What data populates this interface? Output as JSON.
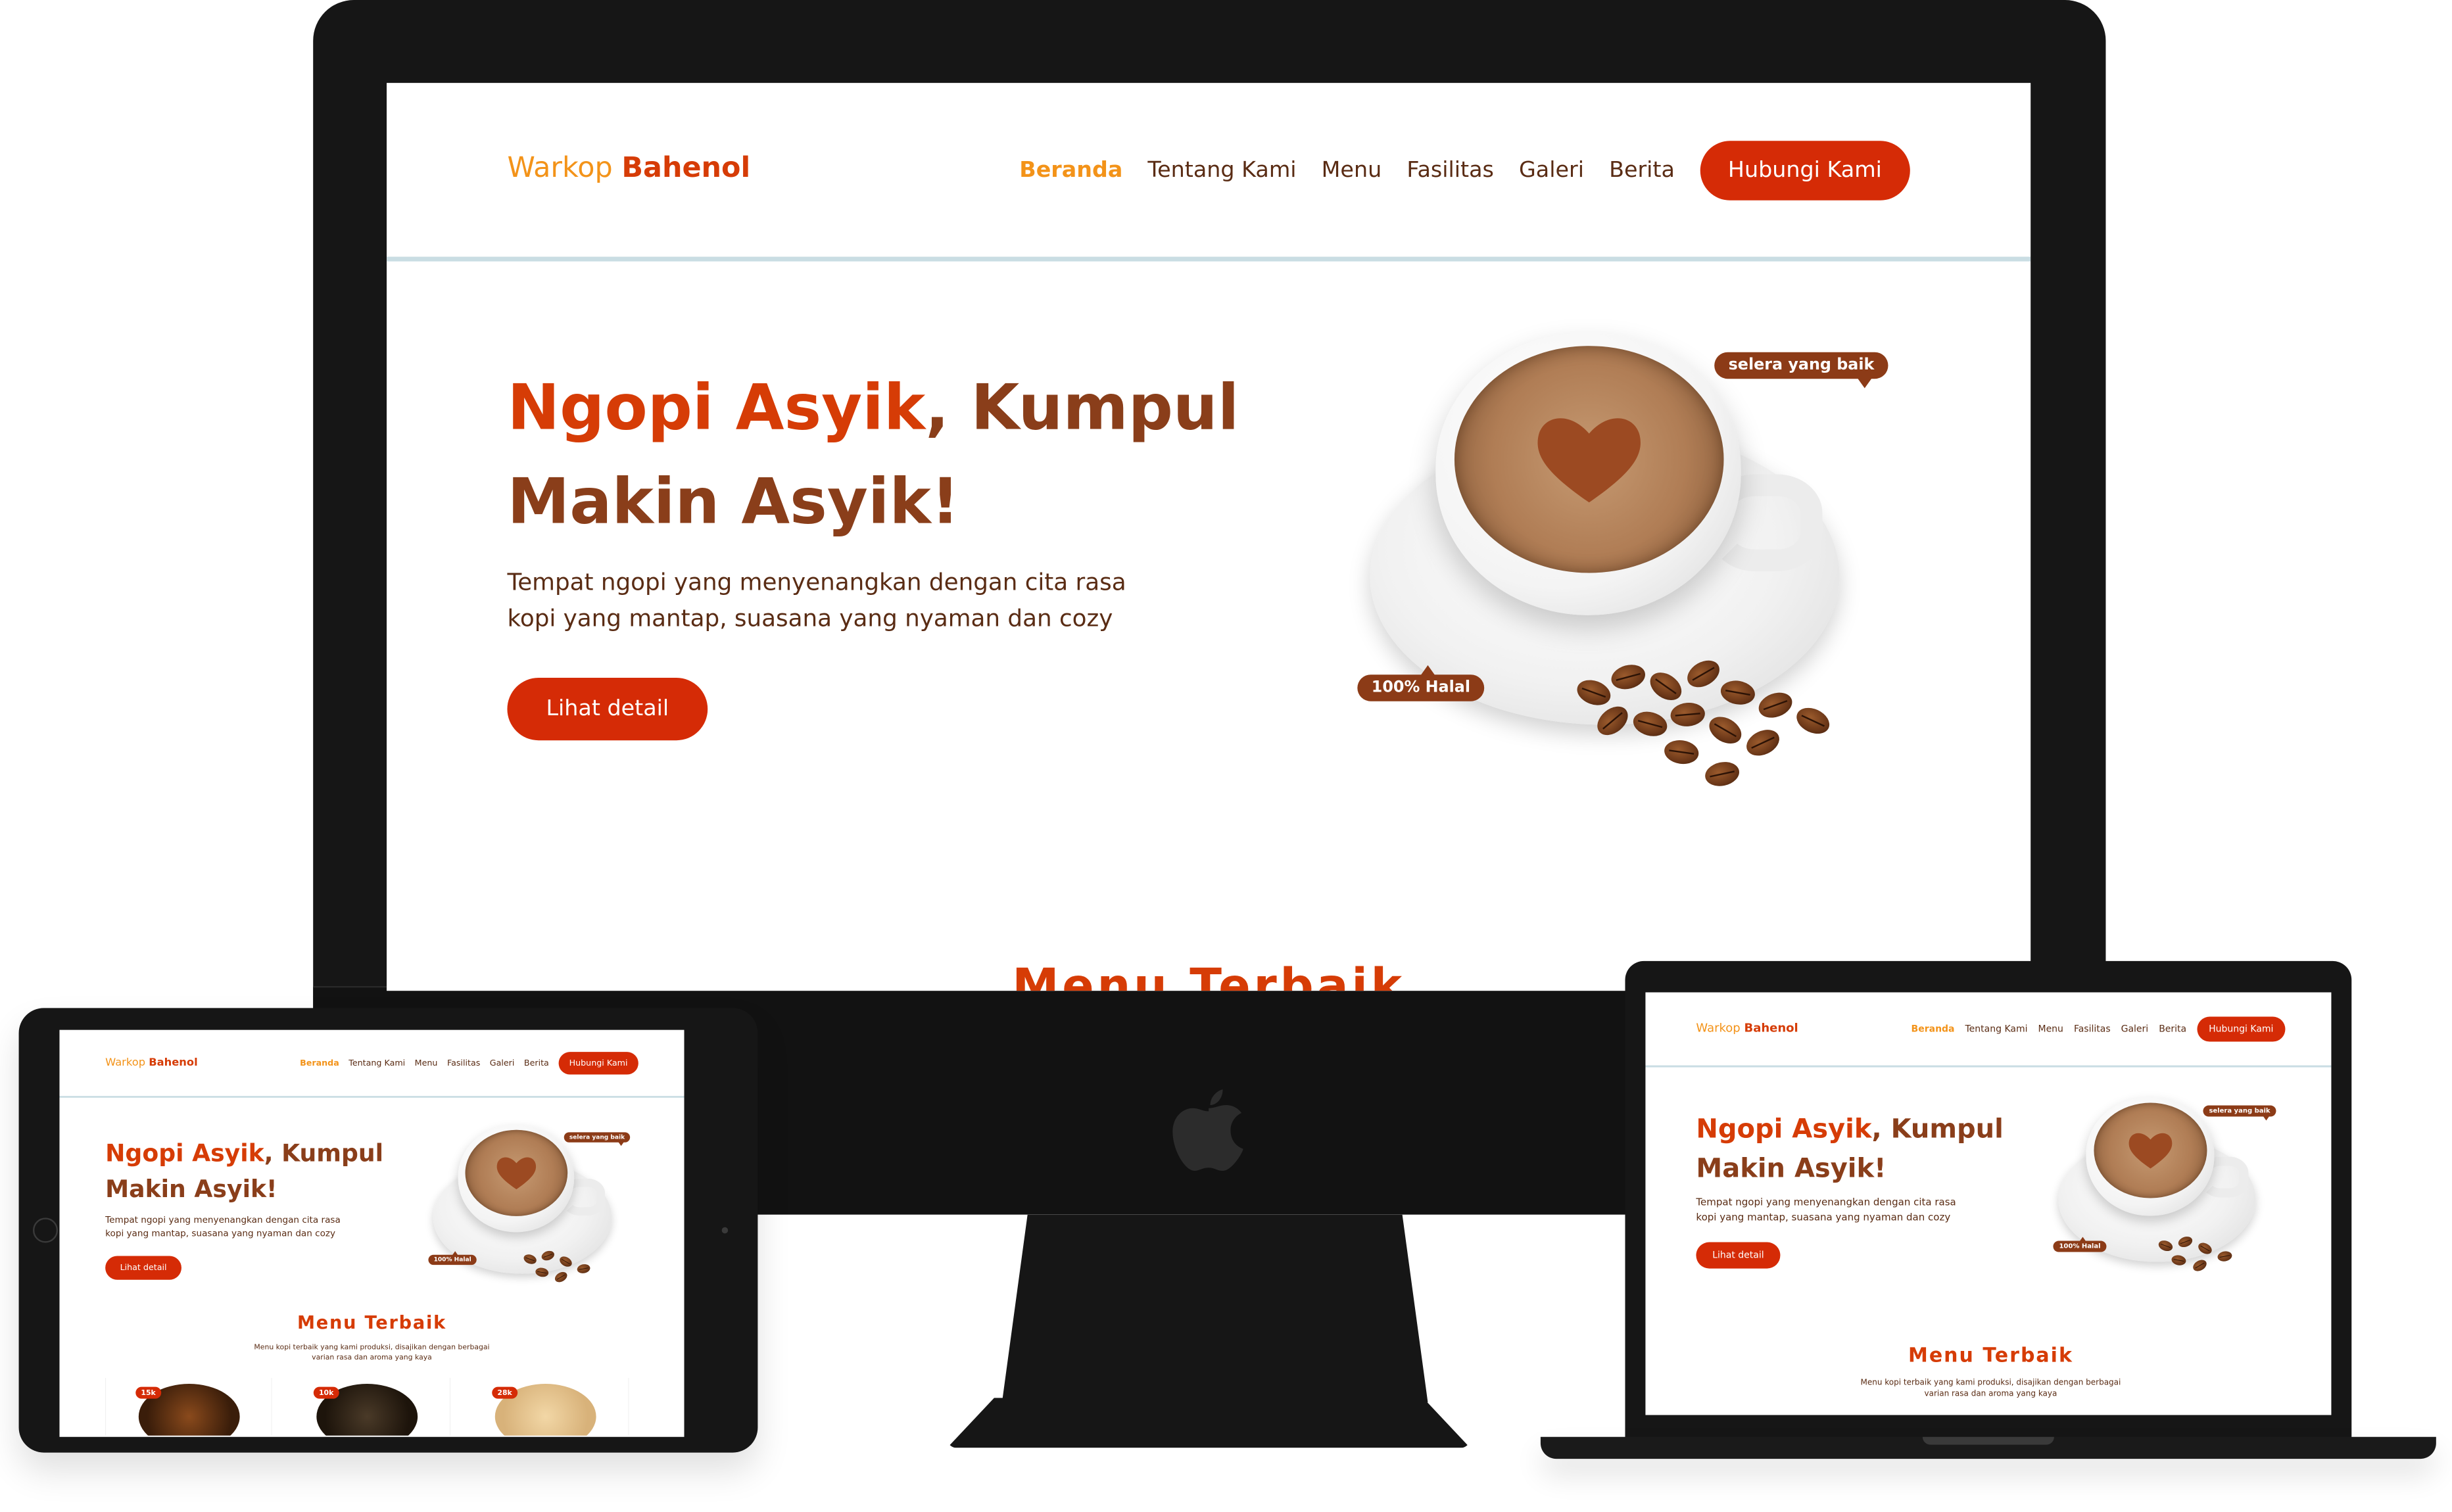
{
  "brand": {
    "part1": "Warkop",
    "part2": "Bahenol"
  },
  "nav": {
    "items": [
      "Beranda",
      "Tentang Kami",
      "Menu",
      "Fasilitas",
      "Galeri",
      "Berita"
    ],
    "cta": "Hubungi Kami"
  },
  "hero": {
    "title_highlight": "Ngopi Asyik",
    "title_rest_line1": ", Kumpul",
    "title_line2": "Makin Asyik!",
    "description": "Tempat ngopi yang menyenangkan dengan cita rasa kopi yang mantap, suasana yang nyaman dan cozy",
    "button": "Lihat detail",
    "badge_top": "selera yang baik",
    "badge_bottom": "100% Halal"
  },
  "menu_section": {
    "title": "Menu Terbaik",
    "subtitle": "Menu kopi terbaik yang kami produksi, disajikan dengan berbagai varian rasa dan aroma yang kaya",
    "prices": [
      "15k",
      "10k",
      "28k"
    ]
  },
  "colors": {
    "accent": "#d52b06",
    "brand_orange": "#f39319",
    "brown": "#8a3e1a",
    "bezel": "#161616"
  }
}
